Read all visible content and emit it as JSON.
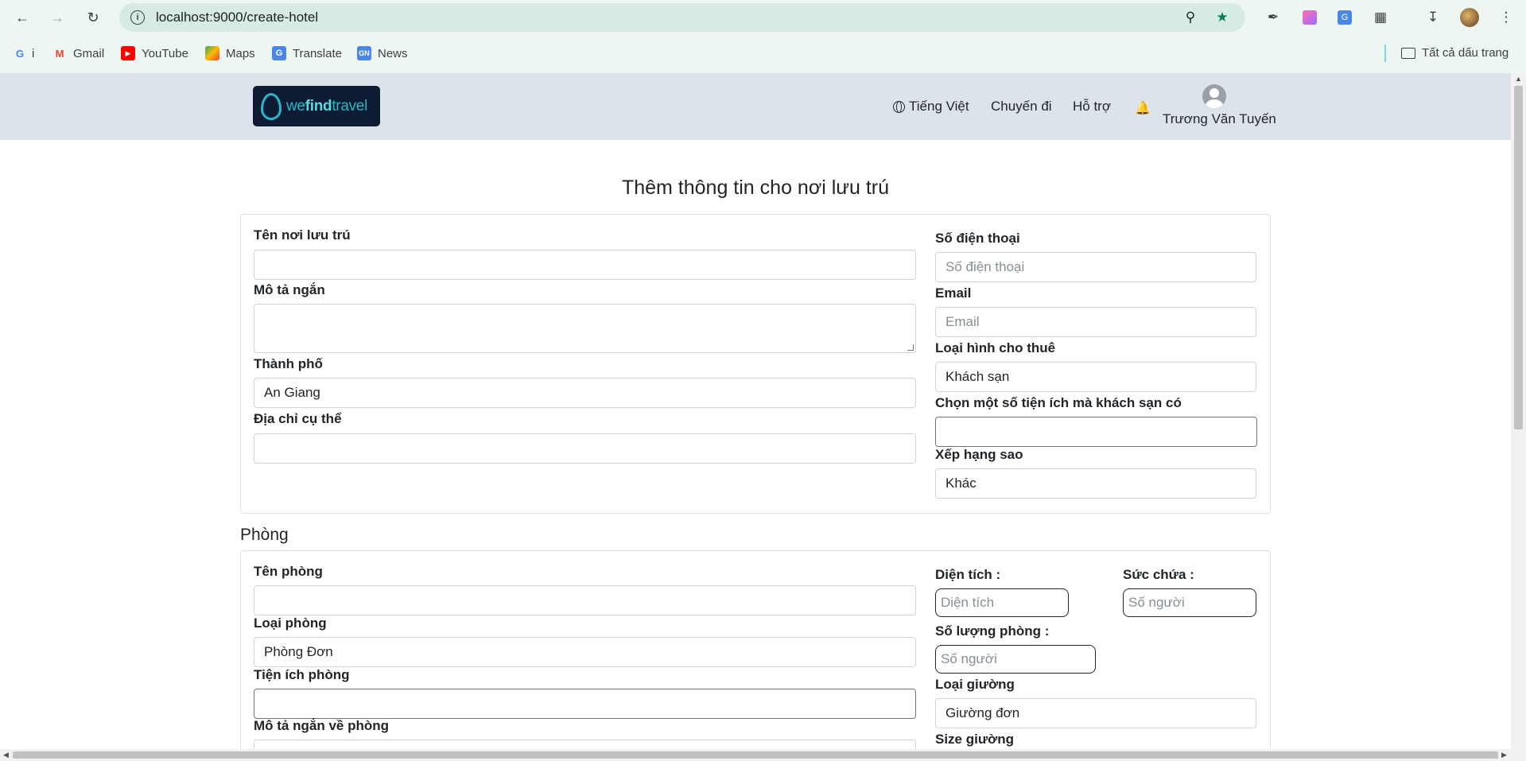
{
  "browser": {
    "url": "localhost:9000/create-hotel",
    "bookmarks": [
      {
        "label": "i",
        "icon": "google-icon"
      },
      {
        "label": "Gmail",
        "icon": "gmail-icon"
      },
      {
        "label": "YouTube",
        "icon": "youtube-icon"
      },
      {
        "label": "Maps",
        "icon": "maps-icon"
      },
      {
        "label": "Translate",
        "icon": "translate-icon"
      },
      {
        "label": "News",
        "icon": "news-icon"
      }
    ],
    "all_bookmarks": "Tất cả dấu trang"
  },
  "header": {
    "logo_text_a": "we",
    "logo_text_b": "find",
    "logo_text_c": "travel",
    "language": "Tiếng Việt",
    "trips": "Chuyến đi",
    "support": "Hỗ trợ",
    "username": "Trương Văn Tuyến"
  },
  "form": {
    "title": "Thêm thông tin cho nơi lưu trú",
    "name_label": "Tên nơi lưu trú",
    "name_value": "",
    "desc_label": "Mô tả ngắn",
    "city_label": "Thành phố",
    "city_value": "An Giang",
    "address_label": "Địa chỉ cụ thể",
    "phone_label": "Số điện thoại",
    "phone_placeholder": "Số điện thoại",
    "email_label": "Email",
    "email_placeholder": "Email",
    "type_label": "Loại hình cho thuê",
    "type_value": "Khách sạn",
    "amenities_label": "Chọn một số tiện ích mà khách sạn có",
    "stars_label": "Xếp hạng sao",
    "stars_value": "Khác"
  },
  "room": {
    "section_title": "Phòng",
    "name_label": "Tên phòng",
    "type_label": "Loại phòng",
    "type_value": "Phòng Đơn",
    "amenities_label": "Tiện ích phòng",
    "desc_label": "Mô tả ngắn về phòng",
    "area_label": "Diện tích :",
    "area_placeholder": "Diện tích",
    "capacity_label": "Sức chứa :",
    "capacity_placeholder": "Số người",
    "count_label": "Số lượng phòng :",
    "count_placeholder": "Số người",
    "bed_type_label": "Loại giường",
    "bed_type_value": "Giường đơn",
    "bed_size_label": "Size giường"
  },
  "colors": {
    "chrome_bg": "#eef6f1",
    "omnibox_bg": "#d6ebe2",
    "site_header_bg": "#dde3eb",
    "logo_bg": "#0d1b33",
    "logo_accent": "#27b7c9"
  }
}
